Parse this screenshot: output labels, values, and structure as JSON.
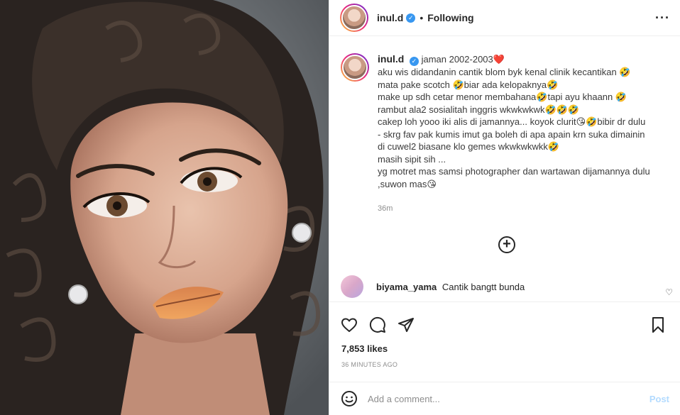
{
  "post": {
    "username": "inul.d",
    "following_label": "Following",
    "more_icon": "more-horizontal-icon"
  },
  "caption": {
    "username": "inul.d",
    "lines": [
      "jaman 2002-2003❤️",
      "aku wis didandanin cantik blom byk kenal clinik kecantikan 🤣",
      "mata pake scotch 🤣biar ada kelopaknya🤣",
      "make up sdh cetar menor membahana🤣tapi ayu khaann 🤣",
      "rambut ala2 sosialitah inggris wkwkwkwk🤣🤣🤣",
      "cakep loh yooo iki alis di jamannya... koyok clurit😘🤣bibir dr dulu",
      "- skrg fav pak kumis imut ga boleh di apa apain krn suka dimainin",
      "di cuwel2 biasane klo gemes wkwkwkwkk🤣",
      "masih sipit sih ...",
      "yg motret mas samsi photographer dan wartawan dijamannya dulu",
      ",suwon mas😘"
    ],
    "time": "36m"
  },
  "comment": {
    "username": "biyama_yama",
    "text": "Cantik bangtt bunda"
  },
  "stats": {
    "likes": "7,853 likes",
    "time_ago": "36 MINUTES AGO"
  },
  "add_comment": {
    "placeholder": "Add a comment...",
    "post_label": "Post"
  },
  "colors": {
    "accent": "#3897f0",
    "post_disabled": "#b3dbff",
    "heart": "#ed4956"
  }
}
